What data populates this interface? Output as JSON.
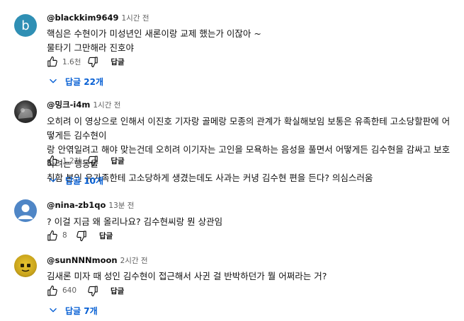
{
  "comments": [
    {
      "avatar_letter": "b",
      "handle": "@blackkim9649",
      "time": "1시간 전",
      "text_lines": [
        "핵심은 수현이가 미성년인 새론이랑 교제 했는가 이잖아 ~",
        "물타기 그만해라 진호야"
      ],
      "likes": "1.6천",
      "reply_label": "답글",
      "replies_label": "답글 22개"
    },
    {
      "handle": "@밍크-i4m",
      "time": "1시간 전",
      "text_lines": [
        "오히려 이 영상으로 인해서 이진호 기자랑 골메랑 모종의 관계가 확실해보임 보통은 유족한테 고소당할판에 어떻게든 김수현이",
        "랑 안엮일려고 해야 맞는건데 오히려 이기자는  고인을 모욕하는 음성을 풀면서 어떻게든 김수현을 감싸고 보호하려는 행동을",
        "취함 본인 유가족한테 고소당하게 생겼는데도 사과는 커녕 김수현 편을 든다? 의심스러움"
      ],
      "likes": "1.2천",
      "reply_label": "답글",
      "replies_label": "답글 10개"
    },
    {
      "handle": "@nina-zb1qo",
      "time": "13분 전",
      "text_lines": [
        "? 이걸 지금 왜 올리나요? 김수현씨랑 뭔 상관임"
      ],
      "likes": "8",
      "reply_label": "답글"
    },
    {
      "handle": "@sunNNNmoon",
      "time": "2시간 전",
      "text_lines": [
        "김새론 미자 때 성인 김수현이 접근해서 사귄 걸 반박하던가 뭘 어쩌라는 거?"
      ],
      "likes": "640",
      "reply_label": "답글",
      "replies_label": "답글 7개"
    }
  ],
  "icons": {
    "like": "thumbs-up-icon",
    "dislike": "thumbs-down-icon",
    "expand": "chevron-down-icon"
  },
  "colors": {
    "link_blue": "#065fd4",
    "meta_gray": "#606060"
  }
}
